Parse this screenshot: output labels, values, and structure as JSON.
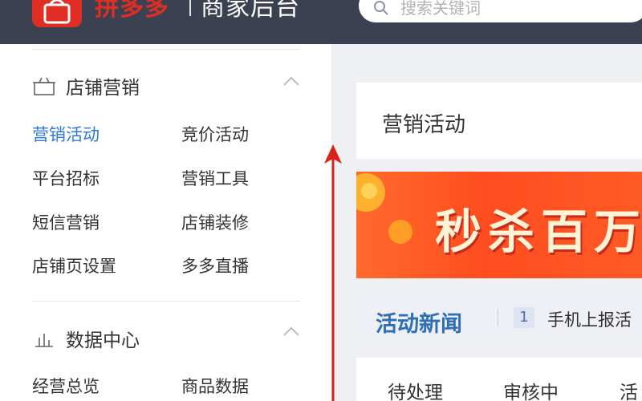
{
  "header": {
    "brand": "拼多多",
    "subtitle": "商家后台",
    "search_placeholder": "搜索关键词"
  },
  "sidebar": {
    "sections": [
      {
        "title": "店铺营销",
        "icon": "gift-icon",
        "items": [
          "营销活动",
          "竞价活动",
          "平台招标",
          "营销工具",
          "短信营销",
          "店铺装修",
          "店铺页设置",
          "多多直播"
        ]
      },
      {
        "title": "数据中心",
        "icon": "bar-chart-icon",
        "items": [
          "经营总览",
          "商品数据"
        ]
      }
    ]
  },
  "main": {
    "title": "营销活动",
    "banner_text": "秒杀百万",
    "news": {
      "title": "活动新闻",
      "number": "1",
      "text": "手机上报活"
    },
    "tabs": [
      "待处理",
      "审核中",
      "活"
    ]
  },
  "colors": {
    "topbar": "#3b4150",
    "brand": "#e02e24",
    "active": "#2d7ad6",
    "banner": "#ff5a26",
    "arrow": "#d9221c"
  }
}
